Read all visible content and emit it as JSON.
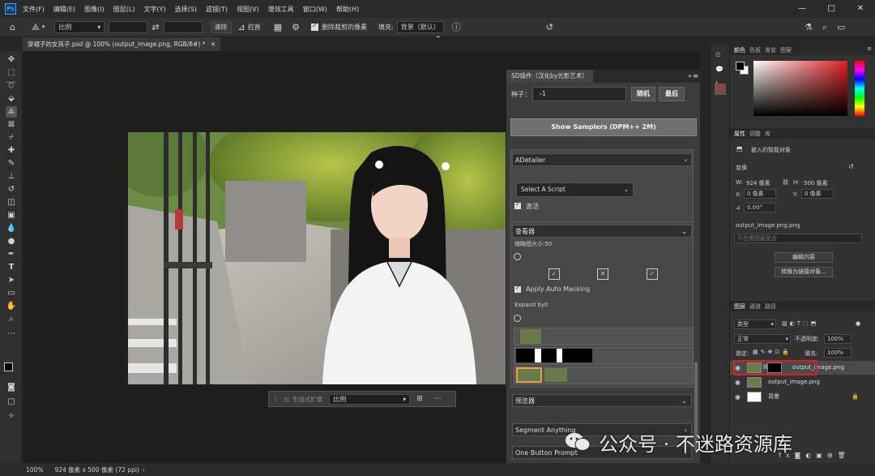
{
  "menubar": {
    "logo": "Ps",
    "items": [
      "文件(F)",
      "编辑(E)",
      "图像(I)",
      "图层(L)",
      "文字(Y)",
      "选择(S)",
      "滤镜(T)",
      "视图(V)",
      "增效工具",
      "窗口(W)",
      "帮助(H)"
    ],
    "window_controls": [
      "—",
      "□",
      "✕"
    ]
  },
  "options": {
    "ratio": "比例",
    "straighten": "拉直",
    "clear": "清除",
    "delete_cropped": "删除裁剪的像素",
    "fill_label": "填充:",
    "fill_value": "背景（默认）"
  },
  "document": {
    "tab_title": "穿裙子的女孩子.psd @ 100% (output_image.png, RGB/8#) *"
  },
  "sd_plugin": {
    "title": "SD插件（汉化by光影艺术）",
    "seed_label": "种子：",
    "seed_value": "-1",
    "random_btn": "随机",
    "last_btn": "最后",
    "show_samplers": "Show Samplers (DPM++ 2M)",
    "adetailer": "ADetailer",
    "select_script": "Select A Script",
    "activate": "激活",
    "viewer": "查看器",
    "thumb_size": "缩略图大小:50",
    "apply_auto_masking": "Apply Auto Masking",
    "expand_by": "Expand by0",
    "preview": "预览器",
    "segment_anything": "Segment Anything",
    "one_button_prompt": "One Button Prompt"
  },
  "context_bar": {
    "generate": "生成式扩展",
    "ratio": "比例"
  },
  "color_panel": {
    "tabs": [
      "颜色",
      "色板",
      "渐变",
      "图案"
    ]
  },
  "properties_panel": {
    "tabs": [
      "属性",
      "调整",
      "库"
    ],
    "object_type": "嵌入的智能对象",
    "transform": "变换",
    "w_label": "W:",
    "w_value": "924 像素",
    "h_label": "H:",
    "h_value": "500 像素",
    "x_label": "X:",
    "x_value": "0 像素",
    "y_label": "Y:",
    "y_value": "0 像素",
    "angle": "0.00°",
    "filename": "output_image.png.png",
    "layer_comp": "不应用图层复合",
    "edit_contents": "编辑内容",
    "convert_to_linked": "转换为链接对象..."
  },
  "layers_panel": {
    "tabs": [
      "图层",
      "通道",
      "路径"
    ],
    "kind": "类型",
    "blend": "正常",
    "opacity_label": "不透明度:",
    "opacity_value": "100%",
    "lock_label": "锁定:",
    "fill_label": "填充:",
    "fill_value": "100%",
    "layers": [
      {
        "name": "output_image.png"
      },
      {
        "name": "output_image.png"
      },
      {
        "name": "背景"
      }
    ]
  },
  "status": {
    "zoom": "100%",
    "size": "924 像素 x 500 像素 (72 ppi)"
  },
  "watermark": {
    "brand": "公众号 · 不迷路资源库"
  },
  "colors": {
    "highlight": "#e02020",
    "accent": "#31a8ff"
  }
}
